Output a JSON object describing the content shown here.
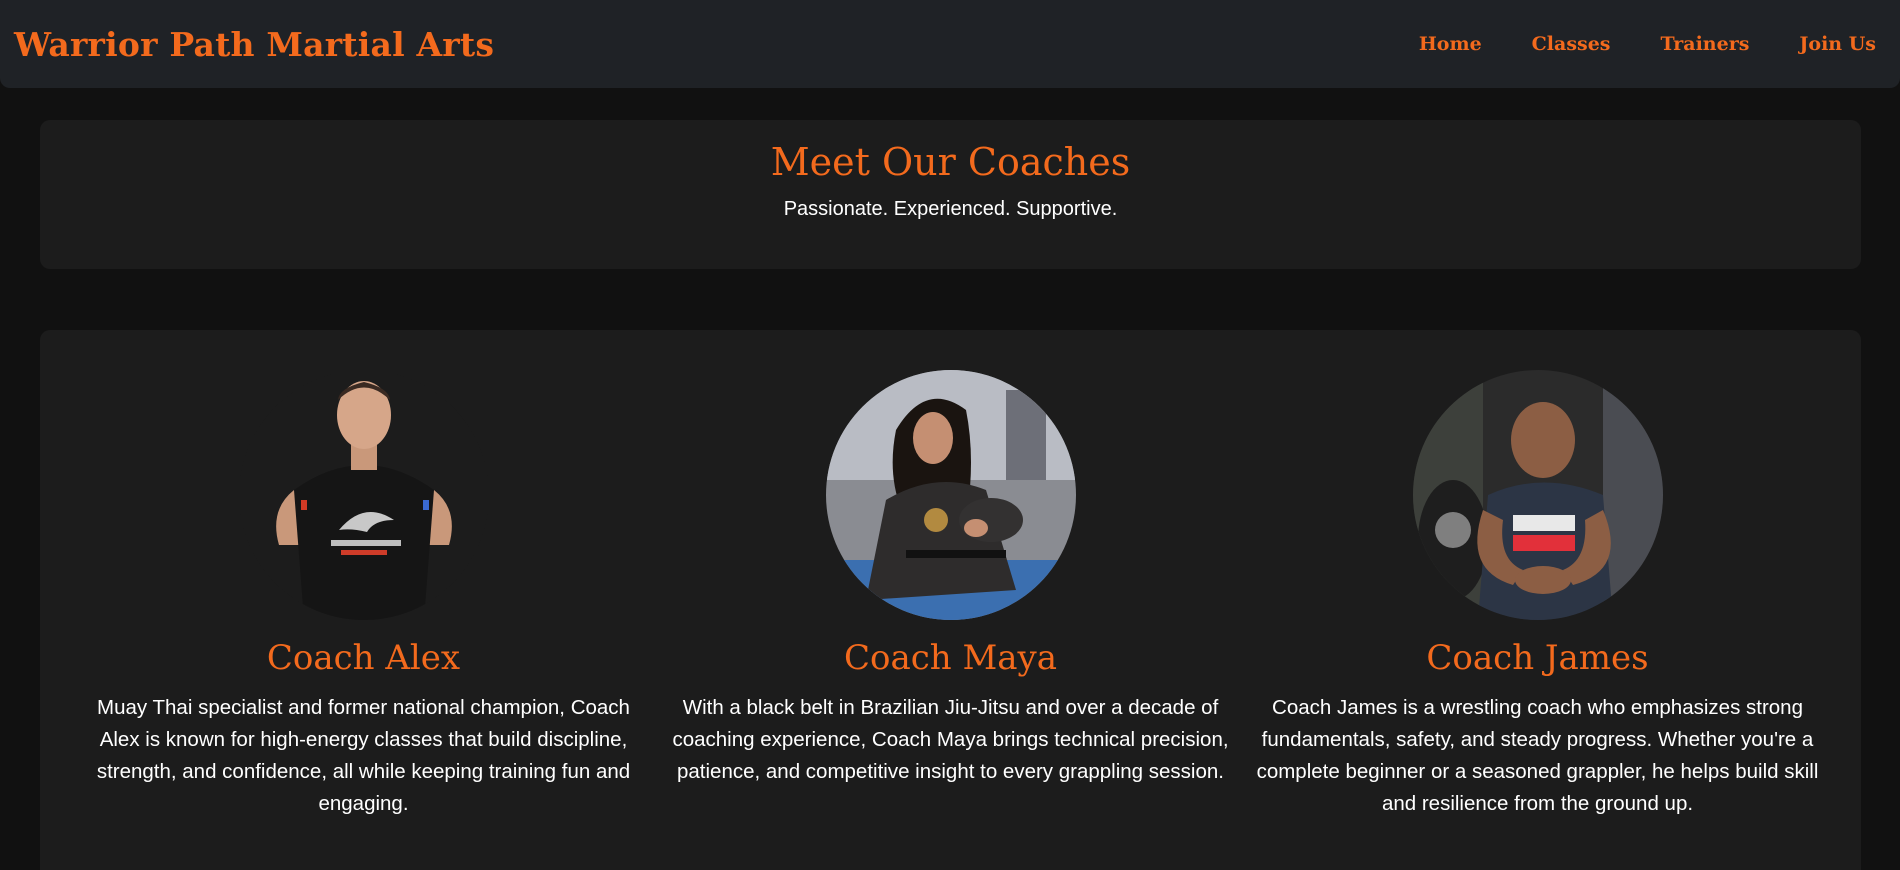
{
  "brand": "Warrior Path Martial Arts",
  "nav": [
    {
      "label": "Home"
    },
    {
      "label": "Classes"
    },
    {
      "label": "Trainers"
    },
    {
      "label": "Join Us"
    }
  ],
  "hero": {
    "title": "Meet Our Coaches",
    "subtitle": "Passionate. Experienced. Supportive."
  },
  "coaches": [
    {
      "name": "Coach Alex",
      "bio": "Muay Thai specialist and former national champion, Coach Alex is known for high-energy classes that build discipline, strength, and confidence, all while keeping training fun and engaging."
    },
    {
      "name": "Coach Maya",
      "bio": "With a black belt in Brazilian Jiu-Jitsu and over a decade of coaching experience, Coach Maya brings technical precision, patience, and competitive insight to every grappling session."
    },
    {
      "name": "Coach James",
      "bio": "Coach James is a wrestling coach who emphasizes strong fundamentals, safety, and steady progress. Whether you're a complete beginner or a seasoned grappler, he helps build skill and resilience from the ground up."
    }
  ],
  "colors": {
    "accent": "#f36a1d",
    "background": "#111111",
    "navbar": "#1f2226",
    "panel": "#1c1c1c"
  }
}
